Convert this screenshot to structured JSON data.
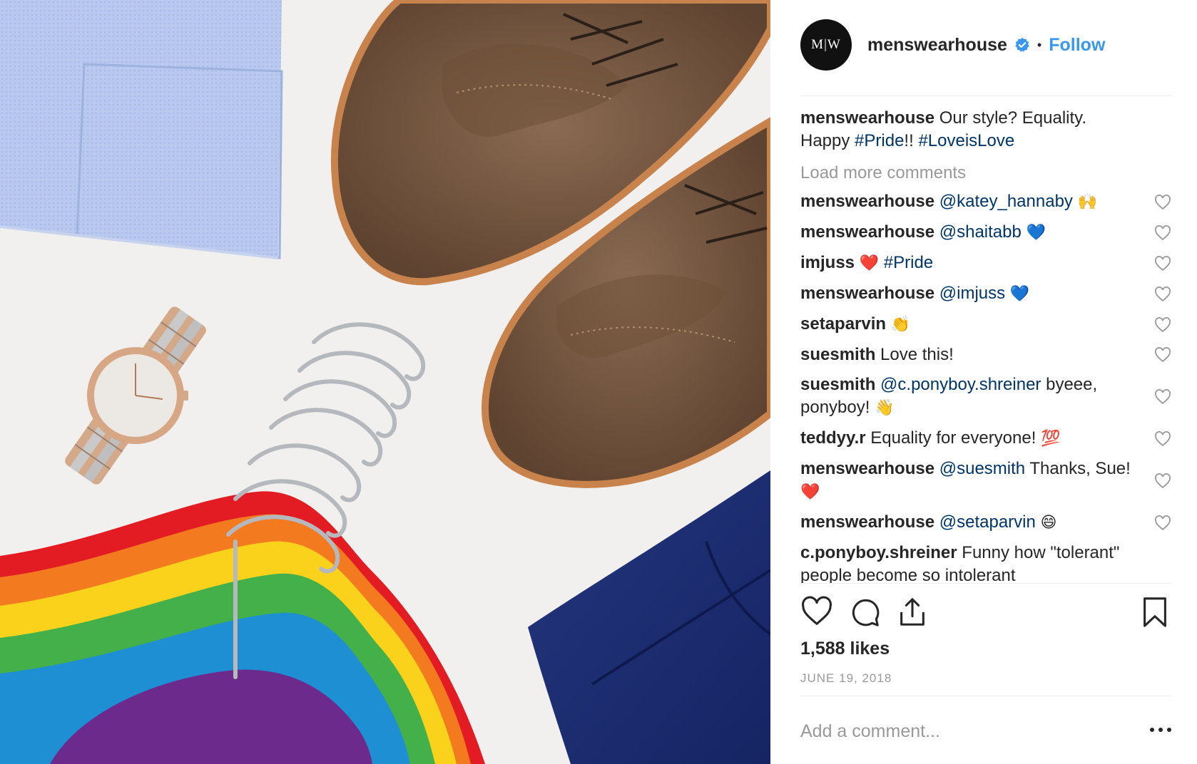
{
  "post": {
    "account": {
      "avatar_text": "M|W",
      "username": "menswearhouse",
      "verified": true,
      "separator": "•",
      "follow_label": "Follow"
    },
    "caption": {
      "username": "menswearhouse",
      "text_1": "Our style? Equality.",
      "text_2": "Happy",
      "tag_1": "#Pride",
      "text_3": "!!",
      "tag_2": "#LoveisLove"
    },
    "load_more_label": "Load more comments",
    "comments": [
      {
        "username": "menswearhouse",
        "mention": "@katey_hannaby",
        "text": "",
        "emoji": "🙌"
      },
      {
        "username": "menswearhouse",
        "mention": "@shaitabb",
        "text": "",
        "emoji": "💙"
      },
      {
        "username": "imjuss",
        "mention": "",
        "emoji_pre": "❤️",
        "tag": "#Pride"
      },
      {
        "username": "menswearhouse",
        "mention": "@imjuss",
        "text": "",
        "emoji": "💙"
      },
      {
        "username": "setaparvin",
        "mention": "",
        "text": "",
        "emoji": "👏"
      },
      {
        "username": "suesmith",
        "mention": "",
        "text": "Love this!",
        "emoji": ""
      },
      {
        "username": "suesmith",
        "mention": "@c.ponyboy.shreiner",
        "text": "byeee, ponyboy!",
        "emoji": "👋"
      },
      {
        "username": "teddyy.r",
        "mention": "",
        "text": "Equality for everyone!",
        "emoji": "💯"
      },
      {
        "username": "menswearhouse",
        "mention": "@suesmith",
        "text": "Thanks, Sue!",
        "emoji": "❤️"
      },
      {
        "username": "menswearhouse",
        "mention": "@setaparvin",
        "text": "",
        "emoji": "😄"
      },
      {
        "username": "c.ponyboy.shreiner",
        "mention": "",
        "text": "Funny how \"tolerant\" people become so intolerant",
        "emoji": ""
      }
    ],
    "likes_label": "1,588 likes",
    "date_label": "JUNE 19, 2018",
    "add_comment_placeholder": "Add a comment...",
    "icons": [
      "heart-icon",
      "comment-icon",
      "share-icon",
      "bookmark-icon",
      "more-options-icon",
      "verified-badge-icon"
    ]
  },
  "colors": {
    "link_blue": "#3897f0",
    "hashtag_blue": "#003569",
    "text": "#262626",
    "muted": "#999999",
    "verified": "#3897f0"
  }
}
